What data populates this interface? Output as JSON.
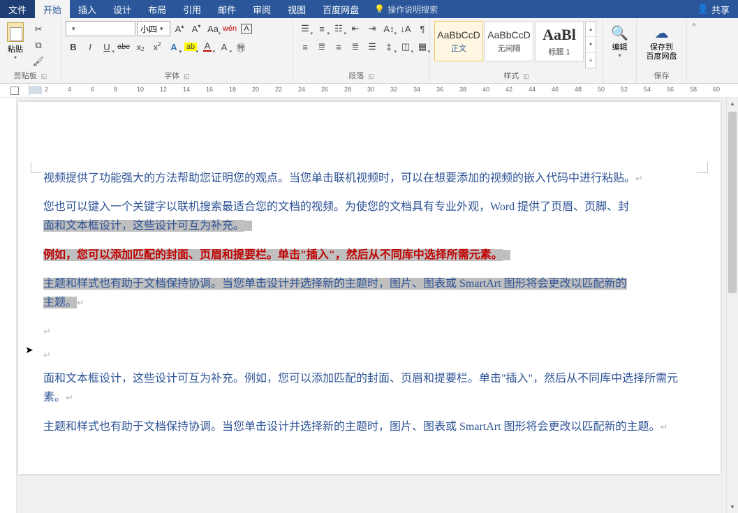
{
  "menubar": {
    "file": "文件",
    "tabs": [
      "开始",
      "插入",
      "设计",
      "布局",
      "引用",
      "邮件",
      "审阅",
      "视图",
      "百度网盘"
    ],
    "active_index": 0,
    "tellme_placeholder": "操作说明搜索",
    "share": "共享"
  },
  "ribbon": {
    "clipboard": {
      "paste": "粘贴",
      "label": "剪贴板"
    },
    "font": {
      "name_value": "",
      "size_value": "小四",
      "label": "字体"
    },
    "paragraph": {
      "label": "段落"
    },
    "styles": {
      "label": "样式",
      "items": [
        {
          "preview": "AaBbCcD",
          "name": "正文",
          "selected": true
        },
        {
          "preview": "AaBbCcD",
          "name": "无间隔",
          "selected": false
        },
        {
          "preview": "AaBl",
          "name": "标题 1",
          "selected": false,
          "big": true
        }
      ]
    },
    "editing": {
      "label": "编辑"
    },
    "save": {
      "button": "保存到\n百度网盘",
      "label": "保存"
    }
  },
  "ruler": {
    "numbers": [
      "2",
      "4",
      "6",
      "8",
      "10",
      "12",
      "14",
      "16",
      "18",
      "20",
      "22",
      "24",
      "26",
      "28",
      "30",
      "32",
      "34",
      "36",
      "38",
      "40",
      "42",
      "44",
      "46",
      "48",
      "50",
      "52",
      "54",
      "56",
      "58",
      "60"
    ]
  },
  "document": {
    "p1": "视频提供了功能强大的方法帮助您证明您的观点。当您单击联机视频时，可以在想要添加的视频的嵌入代码中进行粘贴。",
    "p2a": "您也可以键入一个关键字以联机搜索最适合您的文档的视频。为使您的文档具有专业外观，Word 提供了页眉、页脚、封",
    "p2b_sel": "面和文本框设计，这些设计可互为补充。",
    "p3_sel": "例如，您可以添加匹配的封面、页眉和提要栏。单击\"插入\"，然后从不同库中选择所需元素。",
    "p4a_sel": "主题和样式也有助于文档保持协调。当您单击设计并选择新的主题时，图片、图表或 SmartArt 图形将会更改以匹配新的",
    "p4b_sel": "主题。",
    "p5": "面和文本框设计，这些设计可互为补充。例如，您可以添加匹配的封面、页眉和提要栏。单击\"插入\"，然后从不同库中选择所需元素。",
    "p6": "主题和样式也有助于文档保持协调。当您单击设计并选择新的主题时，图片、图表或 SmartArt 图形将会更改以匹配新的主题。"
  }
}
